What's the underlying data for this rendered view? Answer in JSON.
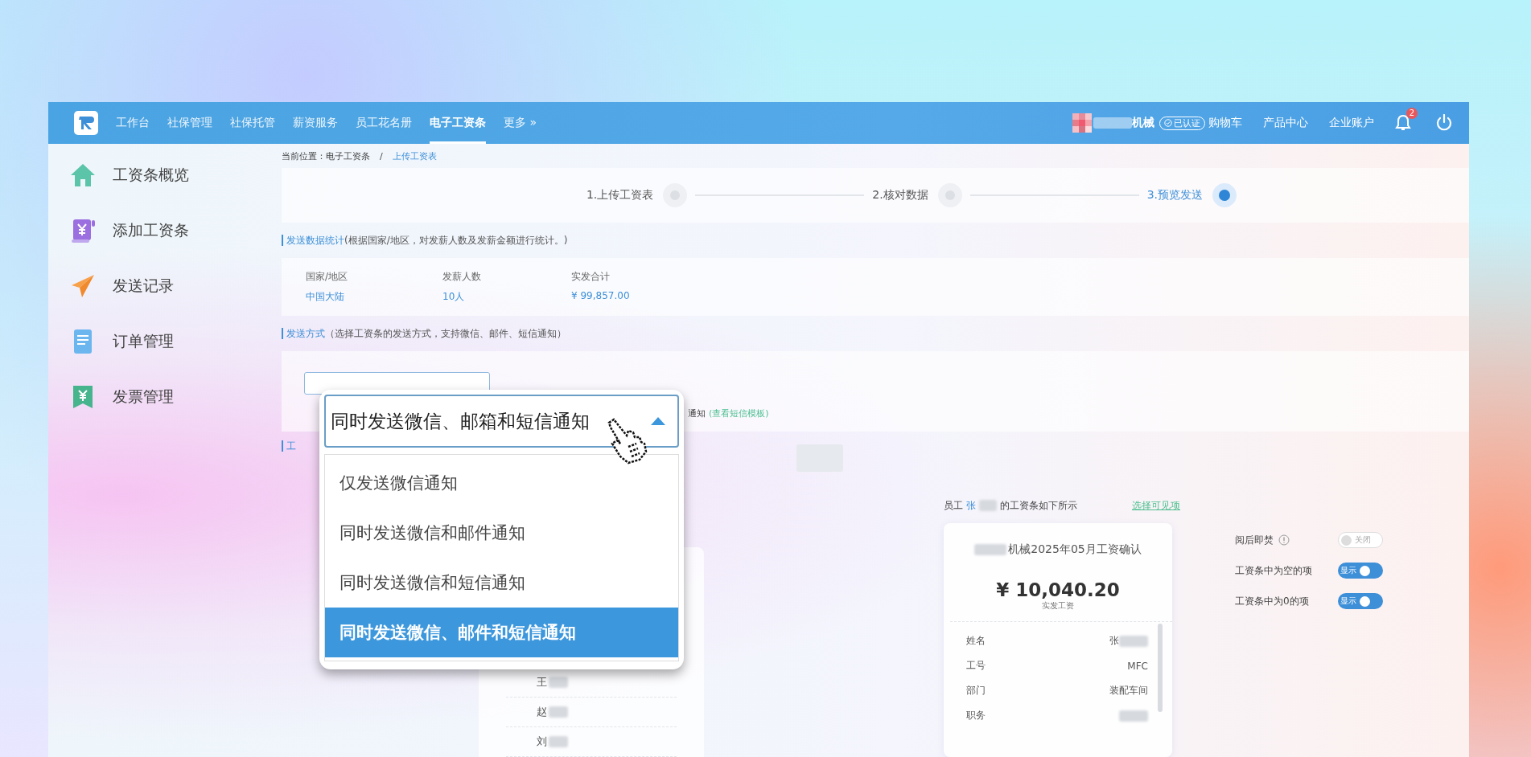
{
  "nav": {
    "items": [
      {
        "label": "工作台",
        "selected": false
      },
      {
        "label": "社保管理",
        "selected": false
      },
      {
        "label": "社保托管",
        "selected": false
      },
      {
        "label": "薪资服务",
        "selected": false
      },
      {
        "label": "员工花名册",
        "selected": false
      },
      {
        "label": "电子工资条",
        "selected": true
      },
      {
        "label": "更多 »",
        "selected": false
      }
    ],
    "company": "机械",
    "verified": "已认证",
    "links": [
      "购物车",
      "产品中心",
      "企业账户"
    ],
    "notifications": "2"
  },
  "sidebar": {
    "items": [
      {
        "label": "工资条概览",
        "kind": "home"
      },
      {
        "label": "添加工资条",
        "kind": "add"
      },
      {
        "label": "发送记录",
        "kind": "send"
      },
      {
        "label": "订单管理",
        "kind": "order"
      },
      {
        "label": "发票管理",
        "kind": "invoice"
      }
    ]
  },
  "breadcrumb": {
    "prefix": "当前位置：电子工资条",
    "separator": "/",
    "current": "上传工资表"
  },
  "steps": [
    {
      "label": "1.上传工资表",
      "selected": false
    },
    {
      "label": "2.核对数据",
      "selected": false
    },
    {
      "label": "3.预览发送",
      "selected": true
    }
  ],
  "stats": {
    "title": "发送数据统计",
    "note": "(根据国家/地区，对发薪人数及发薪金额进行统计。)",
    "columns": [
      "国家/地区",
      "发薪人数",
      "实发合计"
    ],
    "values": [
      "中国大陆",
      "10人",
      "¥ 99,857.00"
    ]
  },
  "send_method": {
    "title": "发送方式",
    "note": "（选择工资条的发送方式，支持微信、邮件、短信通知）",
    "hint": "通知",
    "template_link": "(查看短信模板)"
  },
  "dropdown": {
    "value": "同时发送微信、邮箱和短信通知",
    "expanded": true,
    "options": [
      {
        "label": "仅发送微信通知",
        "selected": false
      },
      {
        "label": "同时发送微信和邮件通知",
        "selected": false
      },
      {
        "label": "同时发送微信和短信通知",
        "selected": false
      },
      {
        "label": "同时发送微信、邮件和短信通知",
        "selected": true
      }
    ]
  },
  "section_3": {
    "title": "工"
  },
  "employee_list": {
    "names": [
      "王",
      "赵",
      "刘"
    ]
  },
  "preview": {
    "prefix": "员工",
    "name": "张",
    "suffix": "的工资条如下所示",
    "link": "选择可见项"
  },
  "payslip": {
    "title": "机械2025年05月工资确认",
    "amount": "¥ 10,040.20",
    "amount_label": "实发工资",
    "rows": [
      {
        "label": "姓名",
        "value": "张"
      },
      {
        "label": "工号",
        "value": "MFC"
      },
      {
        "label": "部门",
        "value": "装配车间"
      },
      {
        "label": "职务"
      }
    ]
  },
  "toggles": [
    {
      "label": "阅后即焚",
      "info": true,
      "on": false,
      "text": "关闭"
    },
    {
      "label": "工资条中为空的项",
      "info": false,
      "on": true,
      "text": "显示"
    },
    {
      "label": "工资条中为0的项",
      "info": false,
      "on": true,
      "text": "显示"
    }
  ]
}
